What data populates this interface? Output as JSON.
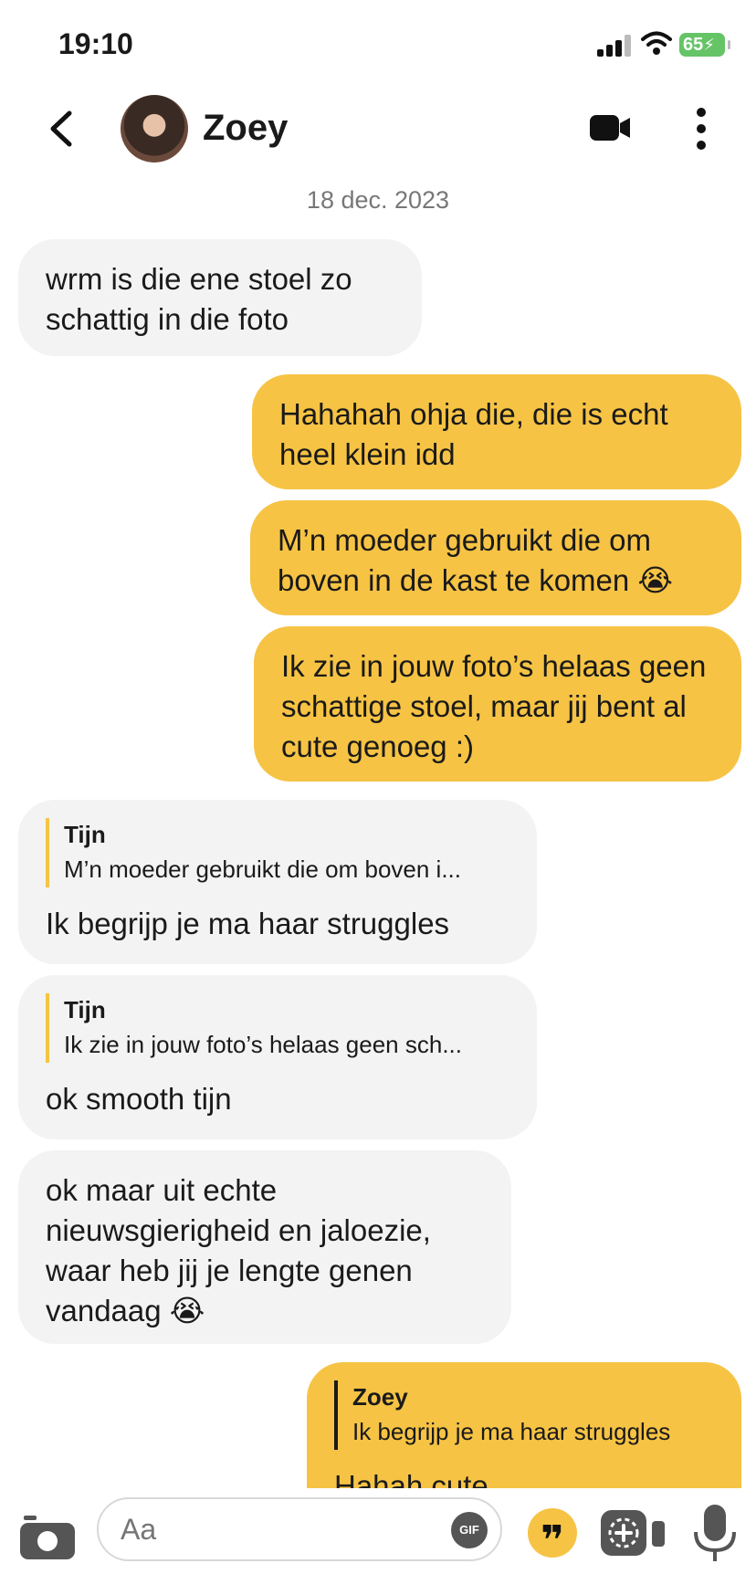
{
  "status": {
    "time": "19:10",
    "battery": "65"
  },
  "header": {
    "contact_name": "Zoey"
  },
  "date_separator": "18 dec. 2023",
  "messages": [
    {
      "text": "wrm is die ene stoel zo schattig in die foto"
    },
    {
      "text": "Hahahah ohja die, die is echt heel klein idd"
    },
    {
      "text": "M’n moeder gebruikt die om boven in de kast te komen 😭"
    },
    {
      "text": "Ik zie in jouw foto’s helaas geen schattige stoel, maar jij bent al cute genoeg :)"
    },
    {
      "quote_name": "Tijn",
      "quote_text": "M’n moeder gebruikt die om boven i...",
      "text": "Ik begrijp je ma haar struggles"
    },
    {
      "quote_name": "Tijn",
      "quote_text": "Ik zie in jouw foto’s helaas geen sch...",
      "text": "ok smooth tijn"
    },
    {
      "text": "ok maar uit echte nieuwsgierigheid en jaloezie, waar heb jij je lengte genen vandaag 😭"
    },
    {
      "quote_name": "Zoey",
      "quote_text": "Ik begrijp je ma haar struggles",
      "text": "Hahah cute"
    }
  ],
  "composer": {
    "placeholder": "Aa",
    "gif_label": "GIF",
    "quote_symbol": "❞"
  },
  "colors": {
    "outgoing": "#f6c344",
    "incoming": "#f3f3f3",
    "battery": "#65c466"
  }
}
